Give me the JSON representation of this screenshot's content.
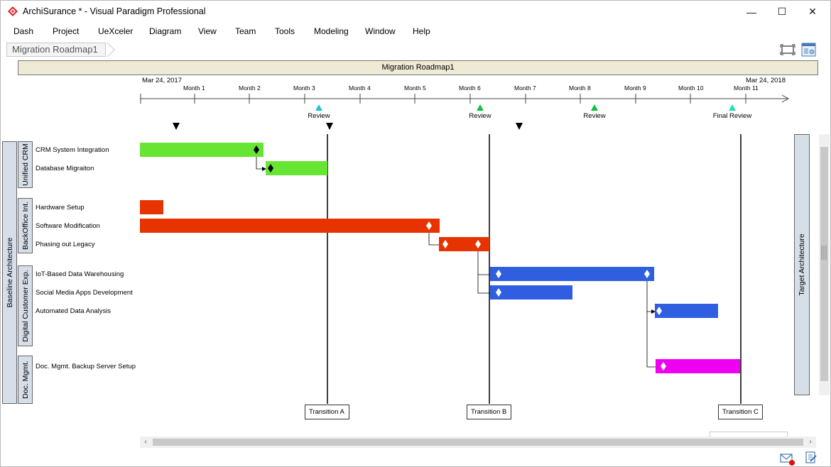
{
  "window": {
    "title": "ArchiSurance * - Visual Paradigm Professional",
    "controls": [
      "—",
      "☐",
      "✕"
    ]
  },
  "menu": [
    "Dash",
    "Project",
    "UeXceler",
    "Diagram",
    "View",
    "Team",
    "Tools",
    "Modeling",
    "Window",
    "Help"
  ],
  "breadcrumb": "Migration Roadmap1",
  "roadmap": {
    "title": "Migration Roadmap1",
    "start_date": "Mar 24, 2017",
    "end_date": "Mar 24, 2018",
    "months": [
      "Month 1",
      "Month 2",
      "Month 3",
      "Month 4",
      "Month 5",
      "Month 6",
      "Month 7",
      "Month 8",
      "Month 9",
      "Month 10",
      "Month 11"
    ],
    "milestones": [
      {
        "label": "Review",
        "month": 3.25,
        "color": "#20c0e0"
      },
      {
        "label": "Review",
        "month": 6.2,
        "color": "#10c040"
      },
      {
        "label": "Review",
        "month": 8.3,
        "color": "#10c040"
      },
      {
        "label": "Final Review",
        "month": 10.75,
        "color": "#20e0b0"
      }
    ],
    "baseline_label": "Baseline Architecture",
    "target_label": "Target Architecture",
    "groups": [
      {
        "label": "Unified CRM"
      },
      {
        "label": "BackOffice Int."
      },
      {
        "label": "Digital Customer Exp."
      },
      {
        "label": "Doc. Mgmt."
      }
    ],
    "tasks": [
      {
        "label": "CRM System Integration",
        "color": "#66e633"
      },
      {
        "label": "Database Migraiton",
        "color": "#66e633"
      },
      {
        "label": "Hardware Setup",
        "color": "#e63300"
      },
      {
        "label": "Software Modification",
        "color": "#e63300"
      },
      {
        "label": "Phasing out Legacy",
        "color": "#e63300"
      },
      {
        "label": "IoT-Based Data Warehousing",
        "color": "#2f5fe0"
      },
      {
        "label": "Social Media Apps Development",
        "color": "#2f5fe0"
      },
      {
        "label": "Automated Data Analysis",
        "color": "#2f5fe0"
      },
      {
        "label": "Doc. Mgmt. Backup Server Setup",
        "color": "#f000f0"
      }
    ],
    "transitions": [
      "Transition A",
      "Transition B",
      "Transition C"
    ]
  },
  "icons": [
    "app-logo-icon",
    "fit-page-icon",
    "diagram-nav-icon",
    "mail-icon",
    "notes-icon"
  ]
}
